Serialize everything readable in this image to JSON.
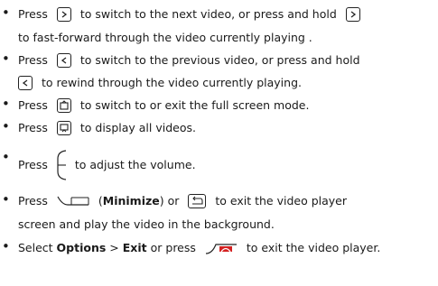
{
  "bullets": [
    {
      "l1": {
        "a": "Press",
        "b": "to switch to the next video, or press and hold"
      },
      "l2": {
        "a": "to fast-forward through the video currently playing ."
      }
    },
    {
      "l1": {
        "a": "Press",
        "b": "to switch to the previous video, or press and hold"
      },
      "l2": {
        "a": "to rewind through the video currently playing."
      }
    },
    {
      "l1": {
        "a": "Press",
        "b": "to switch to or exit the full screen mode."
      }
    },
    {
      "l1": {
        "a": "Press",
        "b": "to display all videos."
      }
    },
    {
      "l1": {
        "a": "Press",
        "b": "to adjust the volume."
      }
    },
    {
      "l1": {
        "a": "Press",
        "b": "(",
        "bold": "Minimize",
        "c": ") or",
        "d": "to exit the video player"
      },
      "l2": {
        "a": "screen and play the video in the background."
      }
    },
    {
      "l1": {
        "a": "Select",
        "bold1": "Options",
        "gt": ">",
        "bold2": "Exit",
        "b": "or press",
        "c": "to exit the video player."
      }
    }
  ],
  "icons": [
    "next-video-key-icon",
    "previous-video-key-icon",
    "fullscreen-key-icon",
    "all-videos-key-icon",
    "volume-key-icon",
    "left-softkey-icon",
    "back-key-icon",
    "end-key-icon"
  ],
  "colors": {
    "end_key_red": "#d32020",
    "text": "#1a1a1a"
  }
}
